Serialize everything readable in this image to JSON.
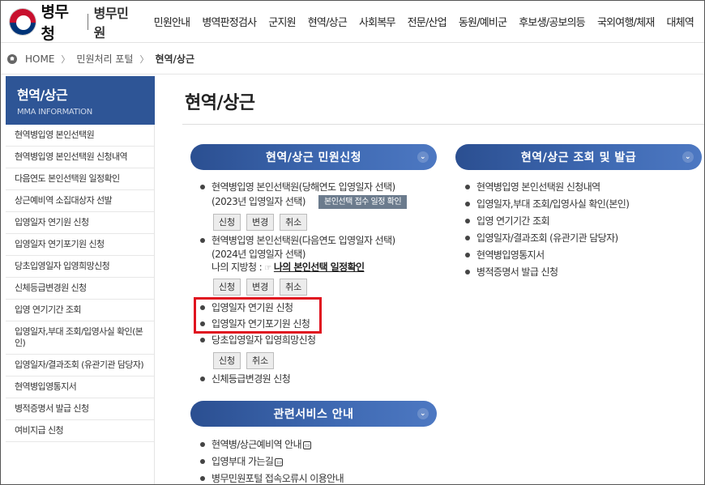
{
  "header": {
    "logo_text": "병무청",
    "logo_sub": "병무민원",
    "nav": [
      "민원안내",
      "병역판정검사",
      "군지원",
      "현역/상근",
      "사회복무",
      "전문/산업",
      "동원/예비군",
      "후보생/공보의등",
      "국외여행/체재",
      "대체역"
    ]
  },
  "breadcrumb": {
    "home": "HOME",
    "items": [
      "민원처리 포털",
      "현역/상근"
    ],
    "separator": "〉"
  },
  "sidebar": {
    "title": "현역/상근",
    "subtitle": "MMA INFORMATION",
    "items": [
      "현역병입영 본인선택원",
      "현역병입영 본인선택원 신청내역",
      "다음연도 본인선택원 일정확인",
      "상근예비역 소집대상자 선발",
      "입영일자 연기원 신청",
      "입영일자 연기포기원 신청",
      "당초입영일자 입영희망신청",
      "신체등급변경원 신청",
      "입영 연기기간 조회",
      "입영일자,부대 조회/입영사실 확인(본인)",
      "입영일자/결과조회 (유관기관 담당자)",
      "현역병입영통지서",
      "병적증명서 발급 신청",
      "여비지급 신청"
    ]
  },
  "main": {
    "title": "현역/상근",
    "apply": {
      "heading": "현역/상근 민원신청",
      "item1_line1": "현역병입영 본인선택원(당해연도 입영일자 선택)",
      "item1_line2": "(2023년 입영일자 선택)",
      "item1_tag": "본인선택 접수 일정 확인",
      "item2_line1": "현역병입영 본인선택원(다음연도 입영일자 선택)",
      "item2_line2": "(2024년 입영일자 선택)",
      "item2_line3_prefix": "나의 지방청 :",
      "item2_hand": "☞",
      "item2_link": "나의 본인선택 일정확인",
      "item3": "입영일자 연기원 신청",
      "item4": "입영일자 연기포기원 신청",
      "item5": "당초입영일자 입영희망신청",
      "item6": "신체등급변경원 신청",
      "btn_apply": "신청",
      "btn_change": "변경",
      "btn_cancel": "취소"
    },
    "lookup": {
      "heading": "현역/상근 조회 및 발급",
      "items": [
        "현역병입영 본인선택원 신청내역",
        "입영일자,부대 조회/입영사실 확인(본인)",
        "입영 연기기간 조회",
        "입영일자/결과조회 (유관기관 담당자)",
        "현역병입영통지서",
        "병적증명서 발급 신청"
      ]
    },
    "related": {
      "heading": "관련서비스 안내",
      "items": [
        "현역병/상근예비역 안내",
        "입영부대 가는길",
        "병무민원포털 접속오류시 이용안내"
      ]
    }
  },
  "icons": {
    "chevron": "chevron-down-icon",
    "home": "home-icon",
    "popup": "popup-window-icon"
  },
  "colors": {
    "primary_blue": "#2e5596",
    "highlight_red": "#e0111f"
  }
}
